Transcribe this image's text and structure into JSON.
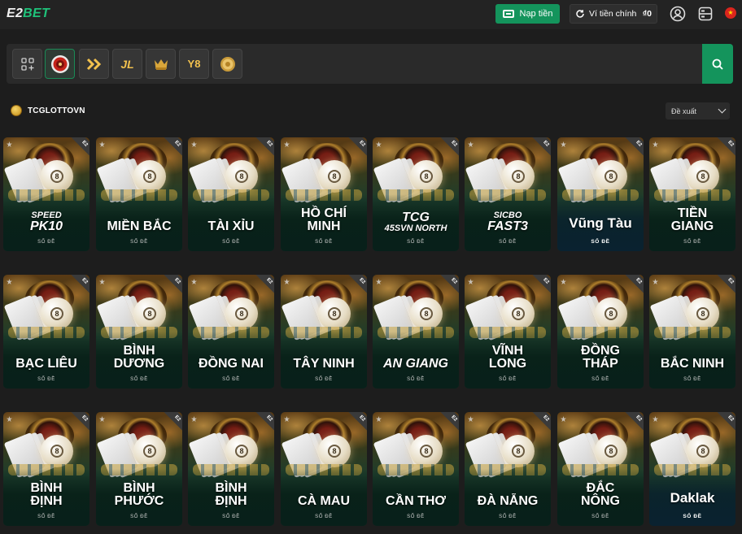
{
  "header": {
    "logo_a": "E2",
    "logo_b": "BET",
    "deposit_label": "Nạp tiền",
    "wallet_label": "Ví tiền chính",
    "wallet_amount": "₫0",
    "flag": "★"
  },
  "providers": [
    {
      "name": "all-games"
    },
    {
      "name": "tcg-lotto",
      "active": true
    },
    {
      "name": "provider-arrows"
    },
    {
      "name": "jili",
      "text": "JL"
    },
    {
      "name": "provider-crown"
    },
    {
      "name": "provider-yb",
      "text": "Y8"
    },
    {
      "name": "provider-coin"
    }
  ],
  "section": {
    "title": "TCGLOTTOVN",
    "sort_label": "Đề xuất"
  },
  "games": [
    {
      "small": "SPEED",
      "title": "PK10",
      "label": "SỐ ĐỀ",
      "style": "italic"
    },
    {
      "title": "MIỀN BẮC",
      "label": "SỐ ĐỀ"
    },
    {
      "title": "TÀI XỈU",
      "label": "SỐ ĐỀ"
    },
    {
      "title": "HỒ CHÍ\nMINH",
      "label": "SỐ ĐỀ"
    },
    {
      "title": "TCG",
      "small_after": "45SVN NORTH",
      "label": "SỐ ĐỀ",
      "style": "italic"
    },
    {
      "small": "SICBO",
      "title": "FAST3",
      "label": "SỐ ĐỀ",
      "style": "italic"
    },
    {
      "title": "Vũng Tàu",
      "label": "SỐ ĐỀ",
      "variant": "blue"
    },
    {
      "title": "TIỀN\nGIANG",
      "label": "SỐ ĐỀ"
    },
    {
      "title": "BẠC LIÊU",
      "label": "SỐ ĐỀ"
    },
    {
      "title": "BÌNH\nDƯƠNG",
      "label": "SỐ ĐỀ"
    },
    {
      "title": "ĐỒNG NAI",
      "label": "SỐ ĐỀ"
    },
    {
      "title": "TÂY NINH",
      "label": "SỐ ĐỀ"
    },
    {
      "title": "AN GIANG",
      "label": "SỐ ĐỀ",
      "style": "italic"
    },
    {
      "title": "VĨNH\nLONG",
      "label": "SỐ ĐỀ"
    },
    {
      "title": "ĐỒNG\nTHÁP",
      "label": "SỐ ĐỀ"
    },
    {
      "title": "BẮC NINH",
      "label": "SỐ ĐỀ"
    },
    {
      "title": "BÌNH\nĐỊNH",
      "label": "SỐ ĐỀ"
    },
    {
      "title": "BÌNH\nPHƯỚC",
      "label": "SỐ ĐỀ"
    },
    {
      "title": "BÌNH\nĐỊNH",
      "label": "SỐ ĐỀ"
    },
    {
      "title": "CÀ MAU",
      "label": "SỐ ĐỀ"
    },
    {
      "title": "CẦN THƠ",
      "label": "SỐ ĐỀ"
    },
    {
      "title": "ĐÀ NẴNG",
      "label": "SỐ ĐỀ"
    },
    {
      "title": "ĐẮC\nNÔNG",
      "label": "SỐ ĐỀ"
    },
    {
      "title": "Daklak",
      "label": "SỐ ĐỀ",
      "variant": "blue"
    }
  ],
  "card_tag": "E2"
}
